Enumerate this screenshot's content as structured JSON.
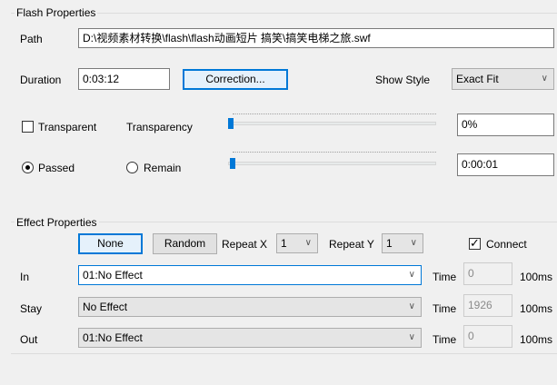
{
  "flash_properties": {
    "title": "Flash Properties",
    "path_label": "Path",
    "path_value": "D:\\视频素材转换\\flash\\flash动画短片 搞笑\\搞笑电梯之旅.swf",
    "duration_label": "Duration",
    "duration_value": "0:03:12",
    "correction_button": "Correction...",
    "show_style_label": "Show Style",
    "show_style_value": "Exact Fit",
    "transparent_label": "Transparent",
    "transparent_checked": false,
    "transparency_label": "Transparency",
    "transparency_value": "0%",
    "transparency_level": 0,
    "passed_label": "Passed",
    "remain_label": "Remain",
    "time_mode": "Passed",
    "position_value": "0:00:01",
    "position_level": 0.01
  },
  "effect_properties": {
    "title": "Effect Properties",
    "none_button": "None",
    "random_button": "Random",
    "repeat_x_label": "Repeat X",
    "repeat_x_value": "1",
    "repeat_y_label": "Repeat Y",
    "repeat_y_value": "1",
    "connect_label": "Connect",
    "connect_checked": true,
    "rows": [
      {
        "label": "In",
        "effect": "01:No Effect",
        "time_label": "Time",
        "time_value": "0",
        "unit": "100ms"
      },
      {
        "label": "Stay",
        "effect": "No Effect",
        "time_label": "Time",
        "time_value": "1926",
        "unit": "100ms"
      },
      {
        "label": "Out",
        "effect": "01:No Effect",
        "time_label": "Time",
        "time_value": "0",
        "unit": "100ms"
      }
    ]
  },
  "colors": {
    "accent": "#0078d7",
    "window_bg": "#f0f0f0"
  }
}
